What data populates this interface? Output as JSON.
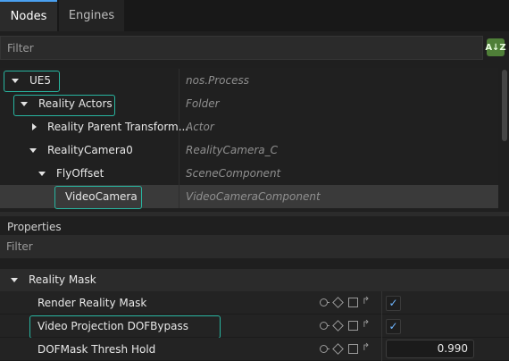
{
  "tabs": [
    {
      "label": "Nodes",
      "active": true
    },
    {
      "label": "Engines",
      "active": false
    }
  ],
  "nodes_filter": {
    "placeholder": "Filter",
    "sort_icon": "sort-az-icon",
    "sort_glyph": "A↓Z"
  },
  "tree": [
    {
      "label": "UE5",
      "type": "nos.Process",
      "expanded": true
    },
    {
      "label": "Reality Actors",
      "type": "Folder",
      "expanded": true
    },
    {
      "label": "Reality Parent Transform...",
      "type": "Actor",
      "expanded": false
    },
    {
      "label": "RealityCamera0",
      "type": "RealityCamera_C",
      "expanded": true
    },
    {
      "label": "FlyOffset",
      "type": "SceneComponent",
      "expanded": true
    },
    {
      "label": "VideoCamera",
      "type": "VideoCameraComponent",
      "selected": true
    }
  ],
  "properties": {
    "title": "Properties",
    "filter_placeholder": "Filter",
    "group": "Reality Mask",
    "rows": [
      {
        "name": "Render Reality Mask",
        "value_type": "checkbox",
        "checked": true
      },
      {
        "name": "Video Projection DOFBypass",
        "value_type": "checkbox",
        "checked": true
      },
      {
        "name": "DOFMask Thresh Hold",
        "value_type": "number",
        "value": "0.990"
      }
    ]
  },
  "colors": {
    "highlight": "#28b5a0",
    "accent": "#4aa0f0",
    "sort_button": "#4f7f38"
  }
}
